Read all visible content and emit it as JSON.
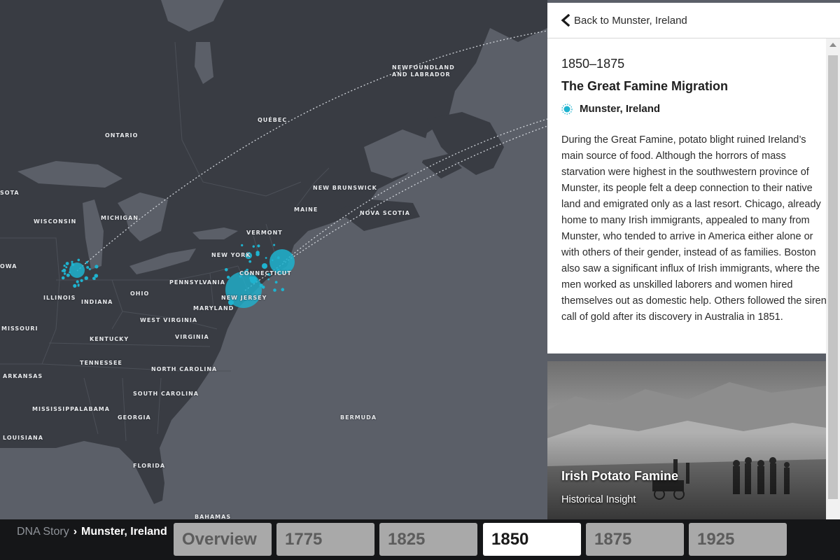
{
  "map": {
    "labels": {
      "newfoundland": "NEWFOUNDLAND",
      "labrador": "AND LABRADOR",
      "quebec": "QUÉBEC",
      "ontario": "ONTARIO",
      "new_brunswick": "NEW BRUNSWICK",
      "maine": "MAINE",
      "nova_scotia": "NOVA SCOTIA",
      "vermont": "VERMONT",
      "new_york": "NEW YORK",
      "connecticut": "CONNECTICUT",
      "new_jersey": "NEW JERSEY",
      "maryland": "MARYLAND",
      "pennsylvania": "PENNSYLVANIA",
      "ohio": "OHIO",
      "michigan": "MICHIGAN",
      "wisconsin": "WISCONSIN",
      "minnesota_partial": "SOTA",
      "iowa_partial": "OWA",
      "illinois": "ILLINOIS",
      "indiana": "INDIANA",
      "west_virginia": "WEST VIRGINIA",
      "virginia": "VIRGINIA",
      "kentucky": "KENTUCKY",
      "missouri": "MISSOURI",
      "tennessee": "TENNESSEE",
      "north_carolina": "NORTH CAROLINA",
      "south_carolina": "SOUTH CAROLINA",
      "arkansas": "ARKANSAS",
      "mississippi": "MISSISSIPPI",
      "alabama": "ALABAMA",
      "georgia": "GEORGIA",
      "louisiana": "LOUISIANA",
      "florida": "FLORIDA",
      "bermuda": "BERMUDA",
      "bahamas": "BAHAMAS"
    },
    "accent_color": "#1fb3cf"
  },
  "panel": {
    "back_label": "Back to Munster, Ireland",
    "era": "1850–1875",
    "title": "The Great Famine Migration",
    "location": "Munster, Ireland",
    "body": "During the Great Famine, potato blight ruined Ireland’s main source of food. Although the horrors of mass starvation were highest in the southwestern province of Munster, its people felt a deep connection to their native land and emigrated only as a last resort. Chicago, already home to many Irish immigrants, appealed to many from Munster, who tended to arrive in America either alone or with others of their gender, instead of as families. Boston also saw a significant influx of Irish immigrants, where the men worked as unskilled laborers and women hired themselves out as domestic help. Others followed the siren call of gold after its discovery in Australia in 1851.",
    "insight_title": "Irish Potato Famine",
    "insight_subtitle": "Historical Insight"
  },
  "footer": {
    "crumb_root": "DNA Story",
    "crumb_sep": "›",
    "crumb_current": "Munster, Ireland",
    "tabs": [
      "Overview",
      "1775",
      "1825",
      "1850",
      "1875",
      "1925"
    ],
    "active_tab": "1850"
  }
}
